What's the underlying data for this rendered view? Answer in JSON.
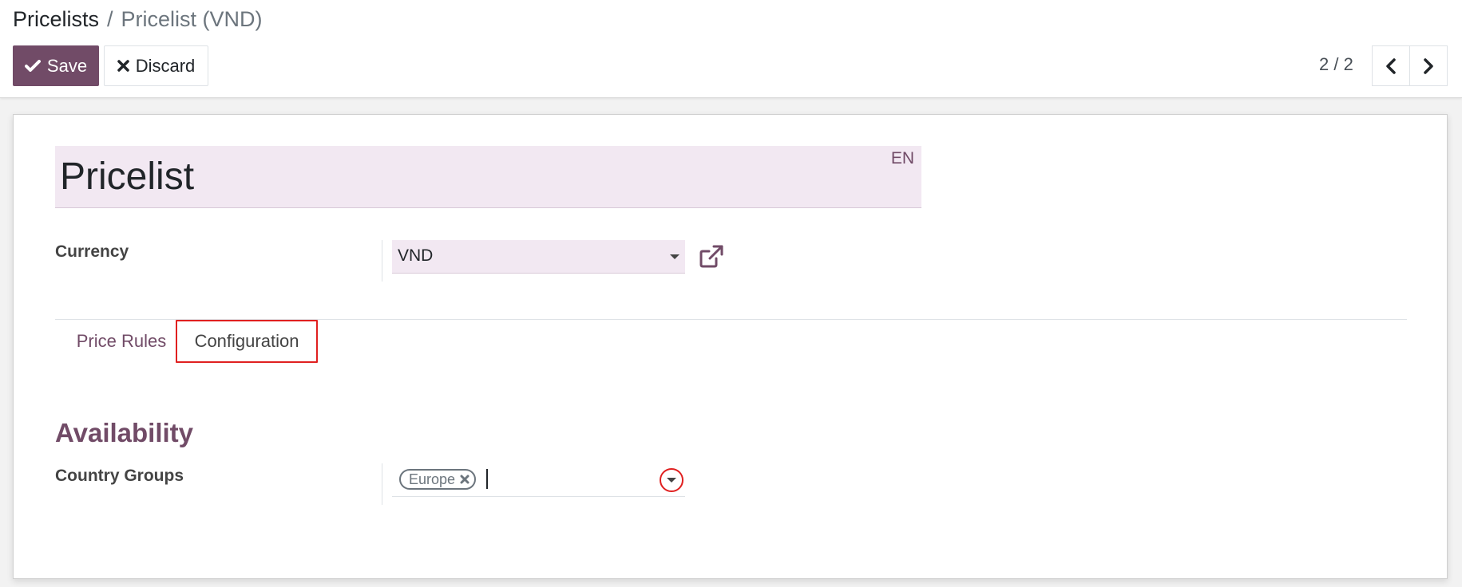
{
  "breadcrumb": {
    "parent": "Pricelists",
    "separator": "/",
    "current": "Pricelist (VND)"
  },
  "toolbar": {
    "save_label": "Save",
    "discard_label": "Discard"
  },
  "pager": {
    "value": "2 / 2"
  },
  "form": {
    "name": "Pricelist",
    "lang": "EN",
    "currency_label": "Currency",
    "currency_value": "VND",
    "tabs": [
      {
        "label": "Price Rules",
        "active": false
      },
      {
        "label": "Configuration",
        "active": true
      }
    ],
    "section_title": "Availability",
    "country_groups_label": "Country Groups",
    "country_groups_tags": [
      "Europe"
    ]
  },
  "colors": {
    "brand": "#714b67",
    "field_bg": "#f2e8f2",
    "highlight": "#e02020"
  },
  "icons": [
    "check-icon",
    "close-icon",
    "chevron-left-icon",
    "chevron-right-icon",
    "external-link-icon",
    "caret-down-icon",
    "tag-remove-icon"
  ]
}
